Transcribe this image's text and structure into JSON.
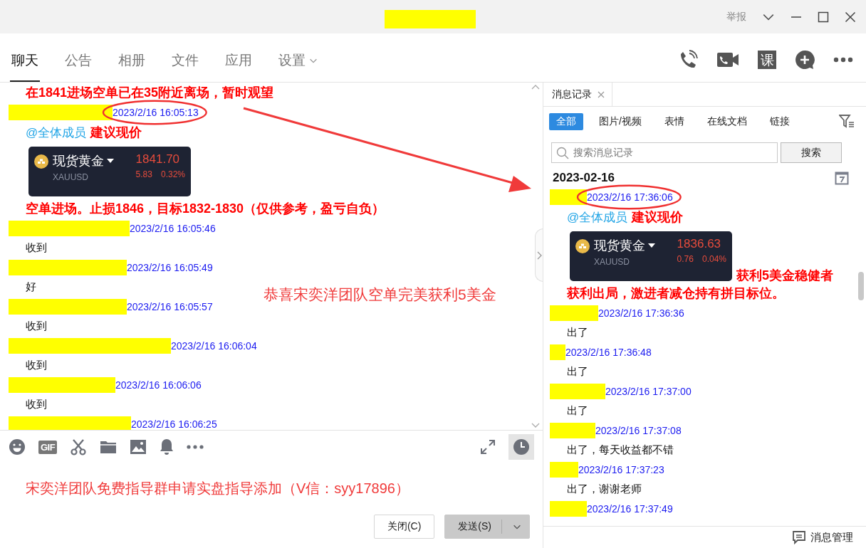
{
  "window": {
    "report": "举报"
  },
  "tabs": [
    {
      "label": "聊天",
      "selected": true,
      "dropdown": false
    },
    {
      "label": "公告",
      "selected": false,
      "dropdown": false
    },
    {
      "label": "相册",
      "selected": false,
      "dropdown": false
    },
    {
      "label": "文件",
      "selected": false,
      "dropdown": false
    },
    {
      "label": "应用",
      "selected": false,
      "dropdown": false
    },
    {
      "label": "设置",
      "selected": false,
      "dropdown": true
    }
  ],
  "course_badge": "课",
  "chat": {
    "items": [
      {
        "kind": "annotation",
        "text": "在1841进场空单已在35附近离场，暂时观望"
      },
      {
        "kind": "header",
        "time": "2023/2/16 16:05:13",
        "circled": true
      },
      {
        "kind": "mention",
        "mention": "@全体成员",
        "text": "建议现价"
      },
      {
        "kind": "card",
        "name": "现货黄金",
        "symbol": "XAUUSD",
        "price": "1841.70",
        "change": "5.83",
        "percent": "0.32%"
      },
      {
        "kind": "annotation",
        "text": "空单进场。止损1846，目标1832-1830（仅供参考，盈亏自负）"
      },
      {
        "kind": "header",
        "time": "2023/2/16 16:05:46",
        "circled": false
      },
      {
        "kind": "text",
        "text": "收到"
      },
      {
        "kind": "header",
        "time": "2023/2/16 16:05:49",
        "circled": false
      },
      {
        "kind": "text",
        "text": "好"
      },
      {
        "kind": "header",
        "time": "2023/2/16 16:05:57",
        "circled": false
      },
      {
        "kind": "text",
        "text": "收到"
      },
      {
        "kind": "header",
        "time": "2023/2/16 16:06:04",
        "circled": false
      },
      {
        "kind": "text",
        "text": "收到"
      },
      {
        "kind": "header",
        "time": "2023/2/16 16:06:06",
        "circled": false
      },
      {
        "kind": "text",
        "text": "收到"
      },
      {
        "kind": "header",
        "time": "2023/2/16 16:06:25",
        "circled": false
      }
    ],
    "overlay_note": "恭喜宋奕洋团队空单完美获利5美金"
  },
  "composer": {
    "gif_label": "GIF",
    "history_open": true,
    "value": "宋奕洋团队免费指导群申请实盘指导添加（V信：syy17896）",
    "buttons": [
      {
        "label": "关闭(C)",
        "kind": "secondary"
      },
      {
        "label": "发送(S)",
        "kind": "primary"
      }
    ]
  },
  "history": {
    "tab": "消息记录",
    "filters": [
      {
        "label": "全部",
        "selected": true
      },
      {
        "label": "图片/视频",
        "selected": false
      },
      {
        "label": "表情",
        "selected": false
      },
      {
        "label": "在线文档",
        "selected": false
      },
      {
        "label": "链接",
        "selected": false
      }
    ],
    "search": {
      "placeholder": "搜索消息记录",
      "button": "搜索"
    },
    "items": [
      {
        "kind": "date",
        "text": "2023-02-16"
      },
      {
        "kind": "header",
        "time": "2023/2/16 17:36:06",
        "circled": true
      },
      {
        "kind": "mention",
        "mention": "@全体成员",
        "text": "建议现价"
      },
      {
        "kind": "card",
        "name": "现货黄金",
        "symbol": "XAUUSD",
        "price": "1836.63",
        "change": "0.76",
        "percent": "0.04%",
        "note": "获利5美金稳健者"
      },
      {
        "kind": "annotation",
        "text": "获利出局，激进者减仓持有拼目标位。"
      },
      {
        "kind": "header",
        "time": "2023/2/16 17:36:36",
        "circled": false
      },
      {
        "kind": "text",
        "text": "出了"
      },
      {
        "kind": "header",
        "time": "2023/2/16 17:36:48",
        "circled": false
      },
      {
        "kind": "text",
        "text": "出了"
      },
      {
        "kind": "header",
        "time": "2023/2/16 17:37:00",
        "circled": false
      },
      {
        "kind": "text",
        "text": "出了"
      },
      {
        "kind": "header",
        "time": "2023/2/16 17:37:08",
        "circled": false
      },
      {
        "kind": "text",
        "text": "出了，每天收益都不错"
      },
      {
        "kind": "header",
        "time": "2023/2/16 17:37:23",
        "circled": false
      },
      {
        "kind": "text",
        "text": "出了，谢谢老师"
      },
      {
        "kind": "header",
        "time": "2023/2/16 17:37:49",
        "circled": false
      }
    ],
    "footer": "消息管理"
  }
}
